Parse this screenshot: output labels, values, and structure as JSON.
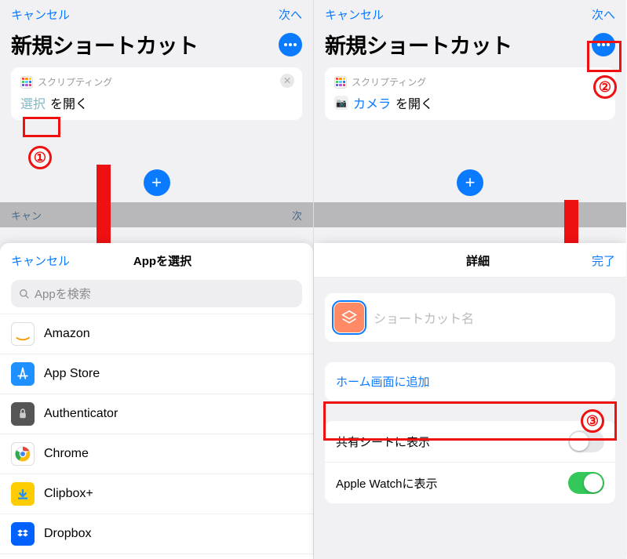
{
  "nav": {
    "cancel": "キャンセル",
    "next": "次へ",
    "done": "完了"
  },
  "shortcut": {
    "new_title": "新規ショートカット",
    "scripting_label": "スクリプティング",
    "select_token": "選択",
    "open_suffix": "を開く",
    "camera_app": "カメラ"
  },
  "app_picker": {
    "title": "Appを選択",
    "search_placeholder": "Appを検索",
    "apps": [
      {
        "name": "Amazon",
        "bg": "#ffffff",
        "icon_svg": "amazon"
      },
      {
        "name": "App Store",
        "bg": "#1e90ff",
        "icon_svg": "appstore"
      },
      {
        "name": "Authenticator",
        "bg": "#555555",
        "icon_svg": "auth"
      },
      {
        "name": "Chrome",
        "bg": "#ffffff",
        "icon_svg": "chrome"
      },
      {
        "name": "Clipbox+",
        "bg": "#ffcc00",
        "icon_svg": "clipbox"
      },
      {
        "name": "Dropbox",
        "bg": "#0061ff",
        "icon_svg": "dropbox"
      }
    ]
  },
  "details": {
    "title": "詳細",
    "name_placeholder": "ショートカット名",
    "add_home": "ホーム画面に追加",
    "share_sheet": "共有シートに表示",
    "apple_watch": "Apple Watchに表示",
    "share_on": false,
    "watch_on": true
  },
  "annotations": {
    "one": "①",
    "two": "②",
    "three": "③"
  },
  "partial": {
    "cancel_cut": "キャン",
    "next_cut": "次"
  }
}
